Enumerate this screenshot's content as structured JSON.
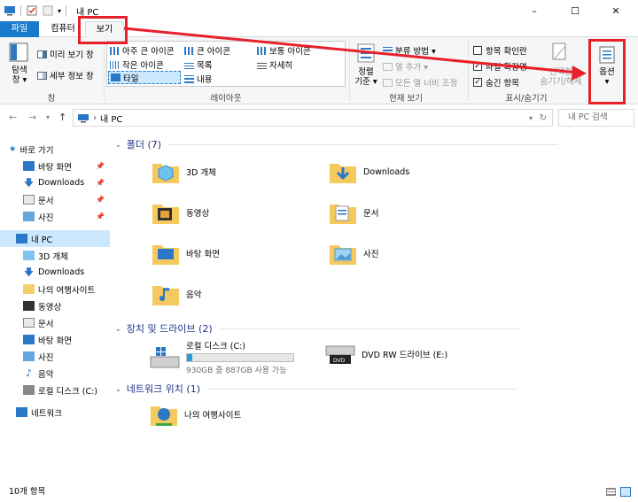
{
  "window": {
    "title": "내 PC",
    "minimize": "–",
    "maximize": "☐",
    "close": "✕"
  },
  "tabs": {
    "file": "파일",
    "computer": "컴퓨터",
    "view": "보기"
  },
  "ribbon": {
    "pane": {
      "nav_label": "탐색\n창 ▾",
      "preview": "미리 보기 창",
      "details": "세부 정보 창",
      "group": "창"
    },
    "layout": {
      "items": [
        "아주 큰 아이콘",
        "큰 아이콘",
        "보통 아이콘",
        "작은 아이콘",
        "목록",
        "자세히",
        "타일",
        "내용"
      ],
      "group": "레이아웃"
    },
    "current_view": {
      "sort": "정렬\n기준 ▾",
      "group_by": "분류 방법 ▾",
      "add_col": "열 추가 ▾",
      "fit_col": "모든 열 너비 조정",
      "group": "현재 보기"
    },
    "show_hide": {
      "checkbox": "항목 확인란",
      "ext": "파일 확장명",
      "hidden": "숨긴 항목",
      "hide_selected": "선택한\n숨기기/해제",
      "group": "표시/숨기기"
    },
    "options": "옵션\n▾"
  },
  "address": {
    "path": "내 PC",
    "search_placeholder": "내 PC 검색"
  },
  "nav": {
    "items": [
      {
        "label": "바로 가기"
      },
      {
        "label": "바탕 화면"
      },
      {
        "label": "Downloads"
      },
      {
        "label": "문서"
      },
      {
        "label": "사진"
      },
      {
        "label": "내 PC"
      },
      {
        "label": "3D 개체"
      },
      {
        "label": "Downloads"
      },
      {
        "label": "나의 여행사이트"
      },
      {
        "label": "동영상"
      },
      {
        "label": "문서"
      },
      {
        "label": "바탕 화면"
      },
      {
        "label": "사진"
      },
      {
        "label": "음악"
      },
      {
        "label": "로컬 디스크 (C:)"
      },
      {
        "label": "네트워크"
      }
    ]
  },
  "content": {
    "folders_head": "폴더 (7)",
    "folders": [
      "3D 개체",
      "Downloads",
      "동영상",
      "문서",
      "바탕 화면",
      "사진",
      "음악"
    ],
    "devices_head": "장치 및 드라이브 (2)",
    "drive_c": {
      "name": "로컬 디스크 (C:)",
      "space": "930GB 중 887GB 사용 가능",
      "used_fraction": 0.05
    },
    "dvd": {
      "name": "DVD RW 드라이브 (E:)"
    },
    "network_head": "네트워크 위치 (1)",
    "network_item": "나의 여행사이트"
  },
  "status": {
    "count": "10개 항목"
  },
  "colors": {
    "accent": "#1979ca",
    "annotation": "#e8202a",
    "heading": "#1e3287"
  }
}
